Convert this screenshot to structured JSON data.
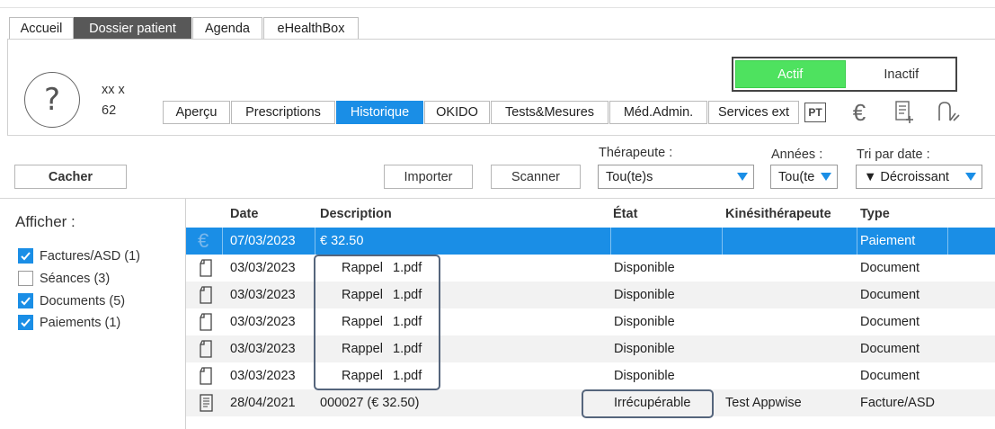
{
  "main_tabs": [
    {
      "label": "Accueil"
    },
    {
      "label": "Dossier patient"
    },
    {
      "label": "Agenda"
    },
    {
      "label": "eHealthBox"
    }
  ],
  "patient": {
    "avatar_glyph": "?",
    "name": "xx x",
    "age": "62"
  },
  "status_toggle": {
    "active": "Actif",
    "inactive": "Inactif"
  },
  "sub_tabs": [
    {
      "label": "Aperçu"
    },
    {
      "label": "Prescriptions"
    },
    {
      "label": "Historique"
    },
    {
      "label": "OKIDO"
    },
    {
      "label": "Tests&Mesures"
    },
    {
      "label": "Méd.Admin."
    },
    {
      "label": "Services ext"
    }
  ],
  "tools": {
    "pt_label": "PT",
    "euro_glyph": "€"
  },
  "filter_bar": {
    "hide_button": "Cacher",
    "import_button": "Importer",
    "scan_button": "Scanner",
    "therapist_label": "Thérapeute :",
    "therapist_value": "Tou(te)s",
    "years_label": "Années :",
    "years_value": "Tou(te",
    "sort_label": "Tri par date :",
    "sort_value": "▼ Décroissant"
  },
  "left_panel": {
    "title": "Afficher :",
    "filters": [
      {
        "label": "Factures/ASD (1)",
        "checked": true
      },
      {
        "label": "Séances (3)",
        "checked": false
      },
      {
        "label": "Documents (5)",
        "checked": true
      },
      {
        "label": "Paiements (1)",
        "checked": true
      }
    ]
  },
  "table": {
    "headers": {
      "date": "Date",
      "description": "Description",
      "state": "État",
      "therapist": "Kinésithérapeute",
      "type": "Type"
    },
    "rows": [
      {
        "icon": "euro-icon",
        "date": "07/03/2023",
        "description": "€ 32.50",
        "desc_file": "",
        "state": "",
        "therapist": "",
        "type": "Paiement"
      },
      {
        "icon": "document-icon",
        "date": "03/03/2023",
        "description": "Rappel",
        "desc_file": "1.pdf",
        "state": "Disponible",
        "therapist": "",
        "type": "Document"
      },
      {
        "icon": "document-icon",
        "date": "03/03/2023",
        "description": "Rappel",
        "desc_file": "1.pdf",
        "state": "Disponible",
        "therapist": "",
        "type": "Document"
      },
      {
        "icon": "document-icon",
        "date": "03/03/2023",
        "description": "Rappel",
        "desc_file": "1.pdf",
        "state": "Disponible",
        "therapist": "",
        "type": "Document"
      },
      {
        "icon": "document-icon",
        "date": "03/03/2023",
        "description": "Rappel",
        "desc_file": "1.pdf",
        "state": "Disponible",
        "therapist": "",
        "type": "Document"
      },
      {
        "icon": "document-icon",
        "date": "03/03/2023",
        "description": "Rappel",
        "desc_file": "1.pdf",
        "state": "Disponible",
        "therapist": "",
        "type": "Document"
      },
      {
        "icon": "invoice-icon",
        "date": "28/04/2021",
        "description": "000027 (€ 32.50)",
        "desc_file": "",
        "state": "Irrécupérable",
        "therapist": "Test Appwise",
        "type": "Facture/ASD"
      }
    ]
  },
  "colors": {
    "accent": "#1a8ee6",
    "active_green": "#4ee25f",
    "tab_dark": "#585858",
    "highlight_border": "#55657c"
  }
}
